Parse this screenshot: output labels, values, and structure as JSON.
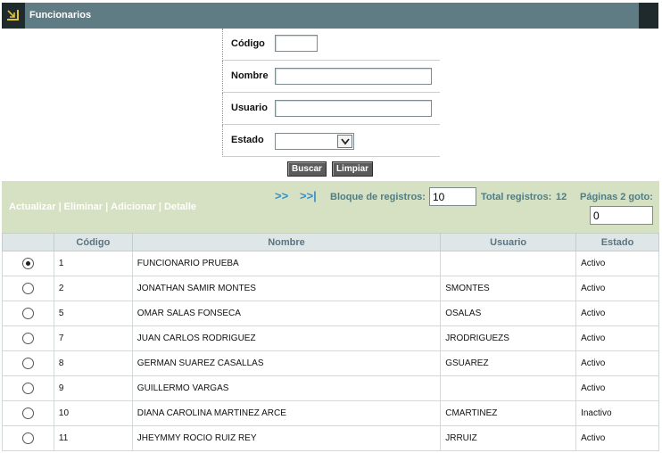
{
  "window": {
    "title": "Funcionarios",
    "icon": "arrow-down-right-icon"
  },
  "search_form": {
    "codigo_label": "Código",
    "codigo_value": "",
    "nombre_label": "Nombre",
    "nombre_value": "",
    "usuario_label": "Usuario",
    "usuario_value": "",
    "estado_label": "Estado",
    "estado_value": "",
    "buscar_label": "Buscar",
    "limpiar_label": "Limpiar"
  },
  "toolbar": {
    "actualizar": "Actualizar",
    "eliminar": "Eliminar",
    "adicionar": "Adicionar",
    "detalle": "Detalle",
    "separator": "|",
    "next": ">>",
    "last": ">>|",
    "bloque_label": "Bloque de registros:",
    "bloque_value": "10",
    "total_label": "Total registros:",
    "total_value": "12",
    "paginas_label": "Páginas 2 goto:",
    "goto_value": "0"
  },
  "table": {
    "headers": [
      "",
      "Código",
      "Nombre",
      "Usuario",
      "Estado"
    ],
    "rows": [
      {
        "selected": true,
        "codigo": "1",
        "nombre": "FUNCIONARIO PRUEBA",
        "usuario": "",
        "estado": "Activo"
      },
      {
        "selected": false,
        "codigo": "2",
        "nombre": "JONATHAN SAMIR MONTES",
        "usuario": "SMONTES",
        "estado": "Activo"
      },
      {
        "selected": false,
        "codigo": "5",
        "nombre": "OMAR SALAS FONSECA",
        "usuario": "OSALAS",
        "estado": "Activo"
      },
      {
        "selected": false,
        "codigo": "7",
        "nombre": "JUAN CARLOS RODRIGUEZ",
        "usuario": "JRODRIGUEZS",
        "estado": "Activo"
      },
      {
        "selected": false,
        "codigo": "8",
        "nombre": "GERMAN SUAREZ CASALLAS",
        "usuario": "GSUAREZ",
        "estado": "Activo"
      },
      {
        "selected": false,
        "codigo": "9",
        "nombre": "GUILLERMO VARGAS",
        "usuario": "",
        "estado": "Activo"
      },
      {
        "selected": false,
        "codigo": "10",
        "nombre": "DIANA CAROLINA MARTINEZ ARCE",
        "usuario": "CMARTINEZ",
        "estado": "Inactivo"
      },
      {
        "selected": false,
        "codigo": "11",
        "nombre": "JHEYMMY ROCIO RUIZ REY",
        "usuario": "JRRUIZ",
        "estado": "Activo"
      }
    ]
  },
  "colors": {
    "titlebar": "#5f7b83",
    "band": "#d6e0c2",
    "link": "#3a8fc0",
    "header_text": "#5a7480"
  }
}
